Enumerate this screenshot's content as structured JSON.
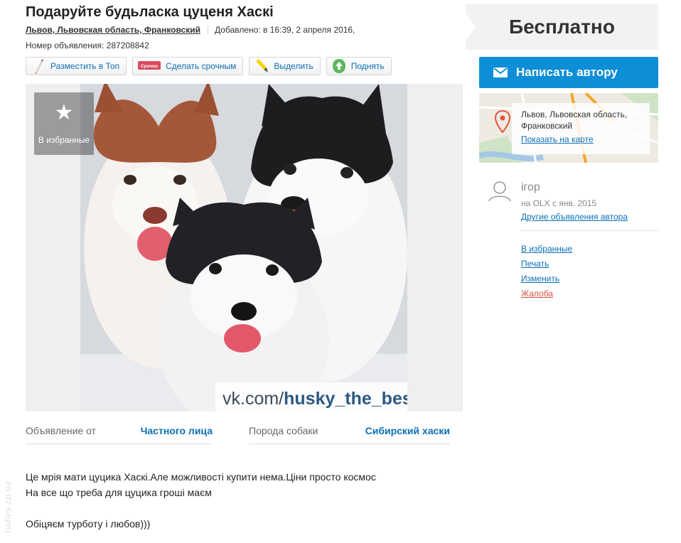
{
  "listing": {
    "title": "Подаруйте будьласка цуценя Хаскі",
    "location": "Львов, Львовская область, Франковский",
    "added": "Добавлено: в 16:39, 2 апреля 2016,",
    "ad_number": "Номер объявления: 287208842"
  },
  "actions": [
    {
      "label": "Разместить в Топ",
      "icon": "rocket-icon"
    },
    {
      "label": "Сделать срочным",
      "icon": "urgent-tag-icon",
      "tag": "Срочно"
    },
    {
      "label": "Выделить",
      "icon": "marker-icon"
    },
    {
      "label": "Поднять",
      "icon": "up-arrow-icon"
    }
  ],
  "photo": {
    "favorite_label": "В избранные",
    "watermark": "vk.com/",
    "watermark_bold": "husky_the_best"
  },
  "params": [
    {
      "key": "Объявление от",
      "value": "Частного лица"
    },
    {
      "key": "Порода собаки",
      "value": "Сибирский хаски"
    }
  ],
  "description": [
    "Це мрія мати цуцика Хаскі.Але можливості купити нема.Ціни просто космос",
    "На все що треба для цуцика гроші маєм",
    "",
    "Обіцяєм турботу і любов)))"
  ],
  "sidebar": {
    "price": "Бесплатно",
    "write_button": "Написать автору",
    "map_address": "Львов, Львовская область, Франковский",
    "map_link": "Показать на карте",
    "user_name": "ігор",
    "user_since": "на OLX с янв. 2015",
    "user_other": "Другие объявления автора",
    "links": [
      "В избранные",
      "Печать",
      "Изменить",
      "Жалоба"
    ]
  },
  "page_watermark": "ludies.zp.ua",
  "colors": {
    "accent": "#0d8ed6",
    "link": "#0b6fb8",
    "complaint": "#d5533e"
  }
}
